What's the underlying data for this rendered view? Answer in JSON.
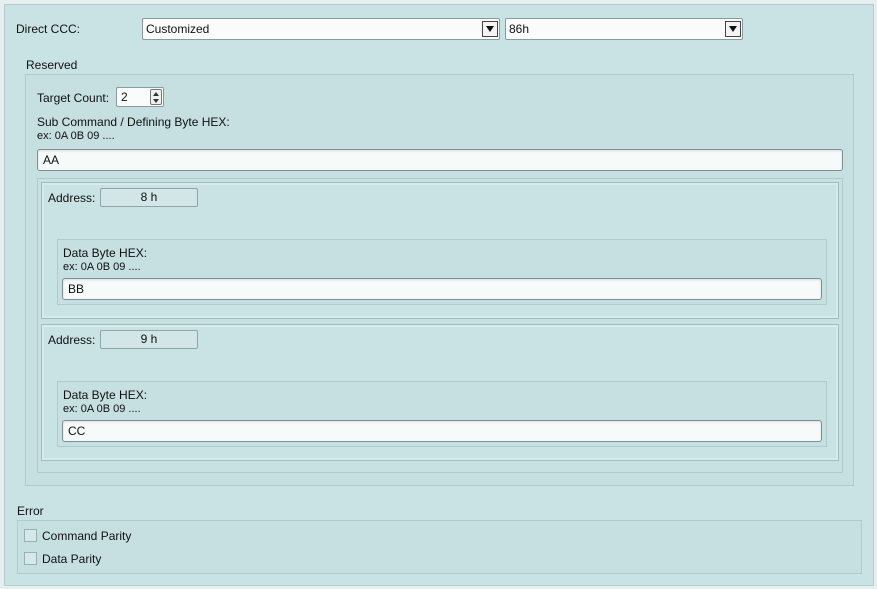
{
  "direct_ccc": {
    "label": "Direct CCC:",
    "mode_value": "Customized",
    "code_value": "86h"
  },
  "reserved": {
    "title": "Reserved",
    "target_count_label": "Target Count:",
    "target_count_value": "2",
    "subcommand_label": "Sub Command / Defining Byte HEX:",
    "subcommand_example": "ex: 0A 0B 09 ....",
    "subcommand_value": "AA",
    "targets": [
      {
        "address_label": "Address:",
        "address_value": "8 h",
        "data_label": "Data Byte HEX:",
        "data_example": "ex: 0A 0B 09 ....",
        "data_value": "BB"
      },
      {
        "address_label": "Address:",
        "address_value": "9 h",
        "data_label": "Data Byte HEX:",
        "data_example": "ex: 0A 0B 09 ....",
        "data_value": "CC"
      }
    ]
  },
  "error": {
    "title": "Error",
    "options": [
      {
        "label": "Command Parity",
        "checked": false
      },
      {
        "label": "Data Parity",
        "checked": false
      }
    ]
  }
}
